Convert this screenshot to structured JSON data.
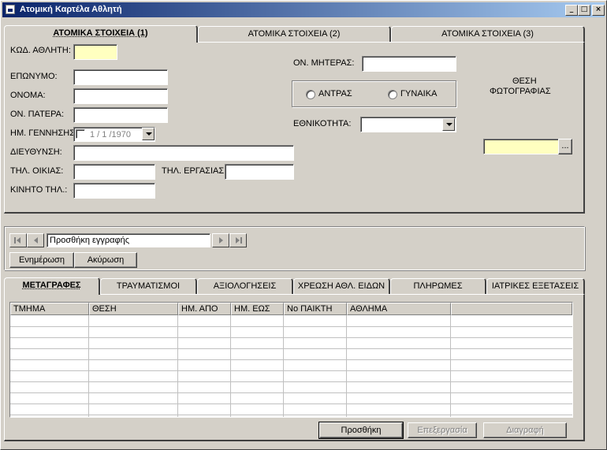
{
  "window": {
    "title": "Ατομική Καρτέλα Αθλητή",
    "controls": {
      "minimize": "_",
      "maximize": "□",
      "close": "×"
    }
  },
  "top_tabs": [
    "ΑΤΟΜΙΚΑ ΣΤΟΙΧΕΙΑ (1)",
    "ΑΤΟΜΙΚΑ ΣΤΟΙΧΕΙΑ (2)",
    "ΑΤΟΜΙΚΑ ΣΤΟΙΧΕΙΑ (3)"
  ],
  "form": {
    "code_label": "ΚΩΔ. ΑΘΛΗΤΗ:",
    "code_value": "",
    "surname_label": "ΕΠΩΝΥΜΟ:",
    "surname_value": "",
    "name_label": "ΟΝΟΜΑ:",
    "name_value": "",
    "father_label": "ΟΝ. ΠΑΤΕΡΑ:",
    "father_value": "",
    "birth_label": "ΗΜ. ΓΕΝΝΗΣΗΣ:",
    "birth_value": "1 / 1 /1970",
    "address_label": "ΔΙΕΥΘΥΝΣΗ:",
    "address_value": "",
    "home_phone_label": "ΤΗΛ. ΟΙΚΙΑΣ:",
    "home_phone_value": "",
    "work_phone_label": "ΤΗΛ. ΕΡΓΑΣΙΑΣ:",
    "work_phone_value": "",
    "mobile_label": "ΚΙΝΗΤΟ ΤΗΛ.:",
    "mobile_value": "",
    "mother_label": "ΟΝ. ΜΗΤΕΡΑΣ:",
    "mother_value": "",
    "gender_male": "ΑΝΤΡΑΣ",
    "gender_female": "ΓΥΝΑΙΚΑ",
    "nationality_label": "ΕΘΝΙΚΟΤΗΤΑ:",
    "nationality_value": "",
    "photo_label_line1": "ΘΕΣΗ",
    "photo_label_line2": "ΦΩΤΟΓΡΑΦΙΑΣ",
    "photo_path": "",
    "browse_label": "..."
  },
  "navigator": {
    "caption": "Προσθήκη εγγραφής",
    "update_label": "Ενημέρωση",
    "cancel_label": "Ακύρωση"
  },
  "bottom_tabs": [
    "ΜΕΤΑΓΡΑΦΕΣ",
    "ΤΡΑΥΜΑΤΙΣΜΟΙ",
    "ΑΞΙΟΛΟΓΗΣΕΙΣ",
    "ΧΡΕΩΣΗ ΑΘΛ. ΕΙΔΩΝ",
    "ΠΛΗΡΩΜΕΣ",
    "ΙΑΤΡΙΚΕΣ ΕΞΕΤΑΣΕΙΣ"
  ],
  "grid": {
    "columns": [
      "ΤΜΗΜΑ",
      "ΘΕΣΗ",
      "ΗΜ. ΑΠΟ",
      "ΗΜ. ΕΩΣ",
      "Νο ΠΑΙΚΤΗ",
      "ΑΘΛΗΜΑ",
      ""
    ]
  },
  "actions": {
    "add_label": "Προσθήκη",
    "edit_label": "Επεξεργασία",
    "delete_label": "Διαγραφή"
  }
}
